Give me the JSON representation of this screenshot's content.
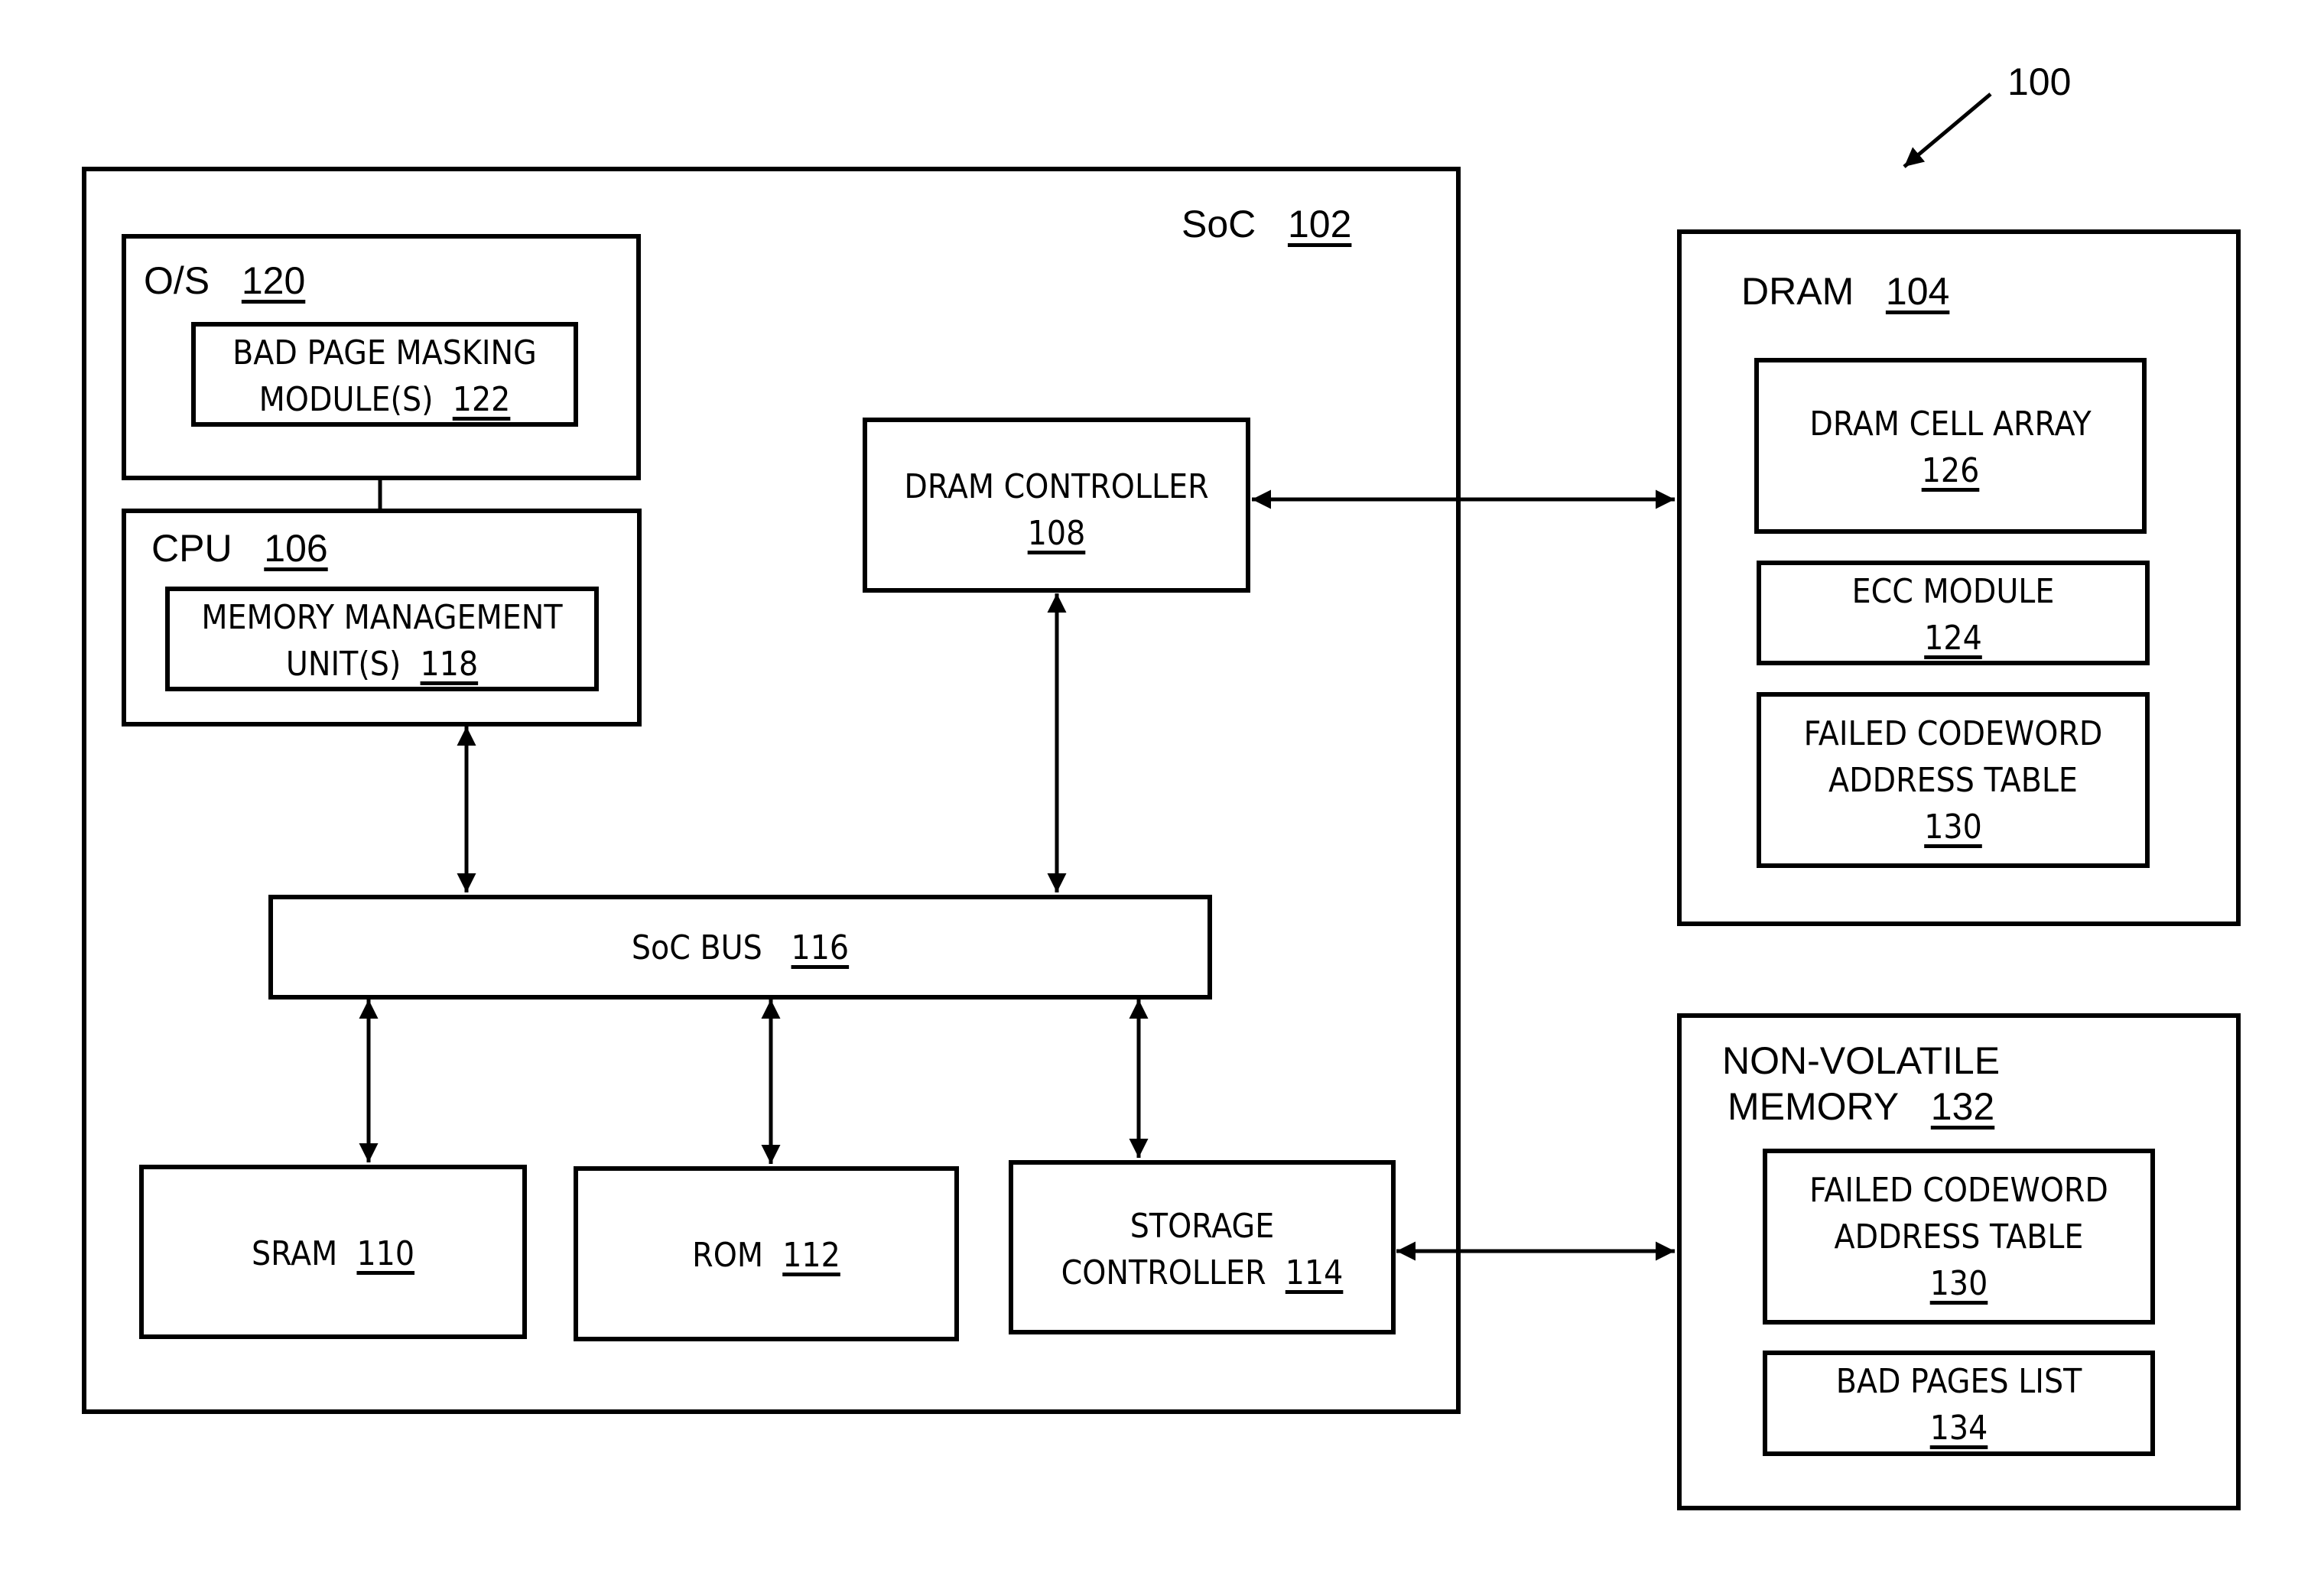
{
  "figure_ref": "100",
  "soc": {
    "title": "SoC",
    "ref": "102"
  },
  "os": {
    "title": "O/S",
    "ref": "120"
  },
  "bad_page_masking": {
    "line1": "BAD PAGE MASKING",
    "line2": "MODULE(S)",
    "ref": "122"
  },
  "cpu": {
    "title": "CPU",
    "ref": "106"
  },
  "mmu": {
    "line1": "MEMORY MANAGEMENT",
    "line2": "UNIT(S)",
    "ref": "118"
  },
  "dram_controller": {
    "line1": "DRAM CONTROLLER",
    "ref": "108"
  },
  "soc_bus": {
    "title": "SoC BUS",
    "ref": "116"
  },
  "sram": {
    "title": "SRAM",
    "ref": "110"
  },
  "rom": {
    "title": "ROM",
    "ref": "112"
  },
  "storage_controller": {
    "line1": "STORAGE",
    "line2": "CONTROLLER",
    "ref": "114"
  },
  "dram": {
    "title": "DRAM",
    "ref": "104"
  },
  "dram_cell_array": {
    "line1": "DRAM CELL ARRAY",
    "ref": "126"
  },
  "ecc_module": {
    "line1": "ECC MODULE",
    "ref": "124"
  },
  "fcat_dram": {
    "line1": "FAILED CODEWORD",
    "line2": "ADDRESS TABLE",
    "ref": "130"
  },
  "nvm": {
    "line1": "NON-VOLATILE",
    "line2": "MEMORY",
    "ref": "132"
  },
  "fcat_nvm": {
    "line1": "FAILED CODEWORD",
    "line2": "ADDRESS TABLE",
    "ref": "130"
  },
  "bad_pages_list": {
    "line1": "BAD PAGES LIST",
    "ref": "134"
  }
}
